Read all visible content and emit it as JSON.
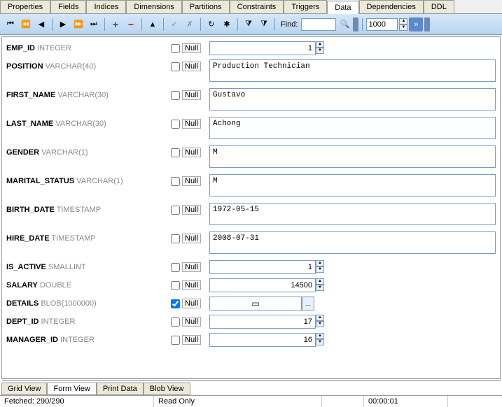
{
  "tabs": [
    "Properties",
    "Fields",
    "Indices",
    "Dimensions",
    "Partitions",
    "Constraints",
    "Triggers",
    "Data",
    "Dependencies",
    "DDL"
  ],
  "active_tab": "Data",
  "toolbar": {
    "find_label": "Find:",
    "find_value": "",
    "limit_value": "1000"
  },
  "fields": [
    {
      "name": "EMP_ID",
      "type": "INTEGER",
      "null": false,
      "kind": "num",
      "value": "1"
    },
    {
      "name": "POSITION",
      "type": "VARCHAR(40)",
      "null": false,
      "kind": "text",
      "value": "Production Technician"
    },
    {
      "name": "FIRST_NAME",
      "type": "VARCHAR(30)",
      "null": false,
      "kind": "text",
      "value": "Gustavo"
    },
    {
      "name": "LAST_NAME",
      "type": "VARCHAR(30)",
      "null": false,
      "kind": "text",
      "value": "Achong"
    },
    {
      "name": "GENDER",
      "type": "VARCHAR(1)",
      "null": false,
      "kind": "text",
      "value": "M"
    },
    {
      "name": "MARITAL_STATUS",
      "type": "VARCHAR(1)",
      "null": false,
      "kind": "text",
      "value": "M"
    },
    {
      "name": "BIRTH_DATE",
      "type": "TIMESTAMP",
      "null": false,
      "kind": "text",
      "value": "1972-05-15"
    },
    {
      "name": "HIRE_DATE",
      "type": "TIMESTAMP",
      "null": false,
      "kind": "text",
      "value": "2008-07-31"
    },
    {
      "name": "IS_ACTIVE",
      "type": "SMALLINT",
      "null": false,
      "kind": "num",
      "value": "1"
    },
    {
      "name": "SALARY",
      "type": "DOUBLE",
      "null": false,
      "kind": "num",
      "value": "14500"
    },
    {
      "name": "DETAILS",
      "type": "BLOB(1000000)",
      "null": true,
      "kind": "blob",
      "value": ""
    },
    {
      "name": "DEPT_ID",
      "type": "INTEGER",
      "null": false,
      "kind": "num",
      "value": "17"
    },
    {
      "name": "MANAGER_ID",
      "type": "INTEGER",
      "null": false,
      "kind": "num",
      "value": "16"
    }
  ],
  "null_label": "Null",
  "bottom_tabs": [
    "Grid View",
    "Form View",
    "Print Data",
    "Blob View"
  ],
  "active_bottom_tab": "Form View",
  "status": {
    "fetched": "Fetched: 290/290",
    "mode": "Read Only",
    "blank": "",
    "time": "00:00:01"
  }
}
